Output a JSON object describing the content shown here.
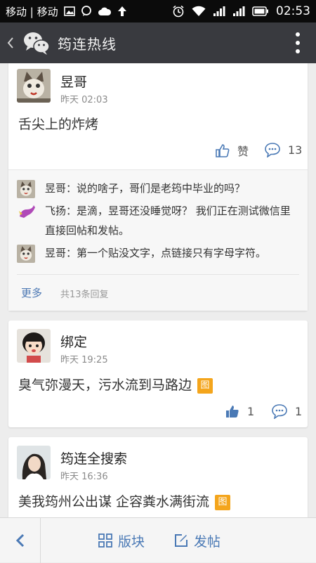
{
  "status_bar": {
    "carrier": "移动 | 移动",
    "time": "02:53",
    "icons": [
      "image-icon",
      "chat-bubble-icon",
      "cloud-icon",
      "upload-arrow-icon",
      "alarm-icon",
      "wifi-icon",
      "signal-icon",
      "signal-icon",
      "battery-icon"
    ]
  },
  "header": {
    "title": "筠连热线",
    "back_icon": "chevron-left-icon",
    "logo_icon": "wechat-logo-icon",
    "menu_icon": "more-vertical-icon"
  },
  "posts": [
    {
      "author": "昱哥",
      "time": "昨天 02:03",
      "text": "舌尖上的炸烤",
      "has_image": false,
      "like_label": "赞",
      "comment_count": "13",
      "replies": [
        {
          "name": "昱哥",
          "sep": "：",
          "text": "说的啥子，哥们是老筠中毕业的吗？"
        },
        {
          "name": "飞扬",
          "sep": "：",
          "text": "是滴，昱哥还没睡觉呀？ 我们正在测试微信里直接回帖和发帖。"
        },
        {
          "name": "昱哥",
          "sep": "：",
          "text": "第一个贴没文字，点链接只有字母字符。"
        }
      ],
      "more_label": "更多",
      "reply_count": "共13条回复"
    },
    {
      "author": "绑定",
      "time": "昨天 19:25",
      "text": "臭气弥漫天，污水流到马路边",
      "has_image": true,
      "image_tag": "图",
      "like_count": "1",
      "comment_count": "1"
    },
    {
      "author": "筠连全搜索",
      "time": "昨天 16:36",
      "text": "美我筠州公出谋 企容粪水满街流",
      "has_image": true,
      "image_tag": "图"
    }
  ],
  "bottom_bar": {
    "back_icon": "chevron-left-icon",
    "sections_label": "版块",
    "sections_icon": "grid-icon",
    "post_label": "发帖",
    "post_icon": "edit-icon"
  },
  "colors": {
    "titlebar": "#393a3f",
    "link_blue": "#4a79b5",
    "image_tag": "#f4a51c"
  }
}
